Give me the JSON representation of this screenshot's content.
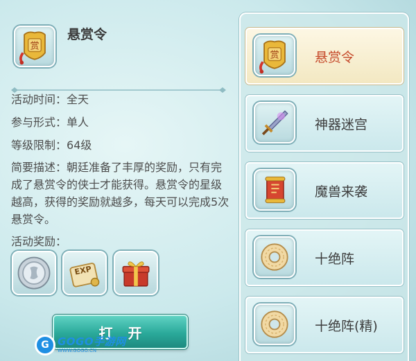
{
  "activity": {
    "name": "悬赏令",
    "time_label": "活动时间：",
    "time_value": "全天",
    "mode_label": "参与形式：",
    "mode_value": "单人",
    "level_label": "等级限制：",
    "level_value": "64级",
    "description": "简要描述：朝廷准备了丰厚的奖励，只有完成了悬赏令的侠士才能获得。悬赏令的星级越高，获得的奖励就越多，每天可以完成5次悬赏令。",
    "rewards_label": "活动奖励：",
    "rewards": [
      {
        "icon": "silver-coin-icon"
      },
      {
        "icon": "exp-scroll-icon"
      },
      {
        "icon": "gift-box-icon"
      }
    ],
    "open_button": "打开"
  },
  "activity_list": [
    {
      "label": "悬赏令",
      "icon": "bounty-token-icon",
      "selected": true
    },
    {
      "label": "神器迷宫",
      "icon": "sword-icon",
      "selected": false
    },
    {
      "label": "魔兽来袭",
      "icon": "scroll-icon",
      "selected": false
    },
    {
      "label": "十绝阵",
      "icon": "jade-disc-icon",
      "selected": false
    },
    {
      "label": "十绝阵(精)",
      "icon": "jade-disc-icon",
      "selected": false
    }
  ],
  "watermark": {
    "logo_letter": "G",
    "brand": "GOGO手游网",
    "url": "WWW.GOGO.CN"
  },
  "colors": {
    "selected_text": "#c5492a",
    "button": "#2aa99a",
    "panel_border": "#ffffff"
  }
}
